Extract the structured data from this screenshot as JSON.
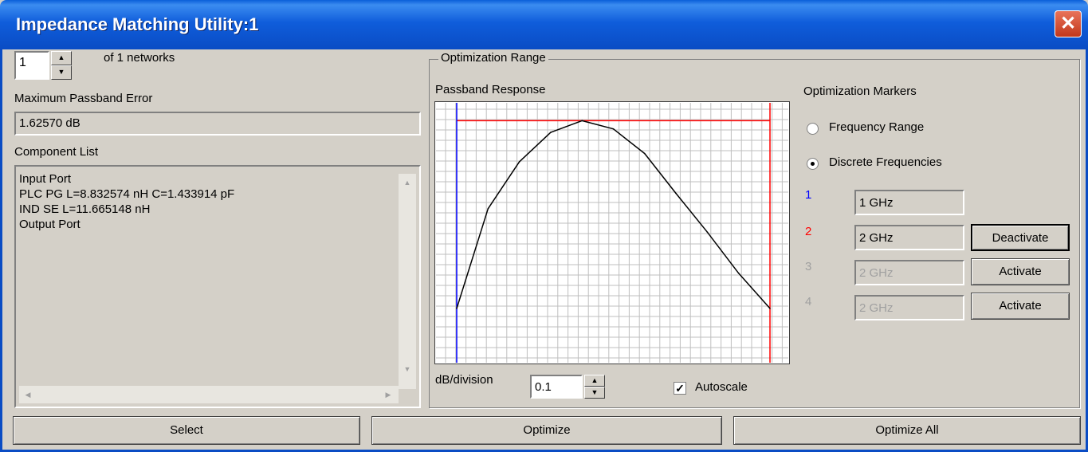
{
  "window": {
    "title": "Impedance Matching Utility:1",
    "close_glyph": "✕"
  },
  "network": {
    "index": "1",
    "of_label": "of 1 networks"
  },
  "passband_error": {
    "label": "Maximum Passband Error",
    "value": "1.62570 dB"
  },
  "component_list": {
    "label": "Component List",
    "lines": [
      "Input Port",
      "PLC  PG  L=8.832574 nH  C=1.433914 pF",
      "IND  SE  L=11.665148 nH",
      "Output Port"
    ]
  },
  "optimization_range": {
    "group_label": "Optimization Range"
  },
  "chart": {
    "label": "Passband Response",
    "db_division_label": "dB/division",
    "db_division_value": "0.1",
    "autoscale_label": "Autoscale",
    "autoscale_checked": true
  },
  "chart_data": {
    "type": "line",
    "title": "Passband Response",
    "xlabel": "",
    "ylabel": "",
    "grid": true,
    "x": [
      0,
      0.1,
      0.2,
      0.3,
      0.4,
      0.5,
      0.6,
      0.7,
      0.8,
      0.9,
      1.0
    ],
    "series": [
      {
        "values": [
          -1.6,
          -0.75,
          -0.35,
          -0.1,
          0.0,
          -0.07,
          -0.28,
          -0.62,
          -0.95,
          -1.3,
          -1.6
        ]
      }
    ],
    "ylim": [
      -1.75,
      0.05
    ],
    "markers": [
      {
        "color": "#0000ff"
      },
      {
        "color": "#ff0000"
      }
    ],
    "colors": {
      "curve": "#000000",
      "grid": "#bfbfbf",
      "top_line": "#ff0000"
    }
  },
  "markers_panel": {
    "label": "Optimization Markers",
    "radio_frequency_range": "Frequency Range",
    "radio_discrete": "Discrete Frequencies",
    "selected": "discrete",
    "markers": [
      {
        "num": "1",
        "value": "1 GHz",
        "button": "",
        "color": "#0000ff",
        "enabled": true
      },
      {
        "num": "2",
        "value": "2 GHz",
        "button": "Deactivate",
        "color": "#ff0000",
        "enabled": true
      },
      {
        "num": "3",
        "value": "2 GHz",
        "button": "Activate",
        "color": "#a0a0a0",
        "enabled": false
      },
      {
        "num": "4",
        "value": "2 GHz",
        "button": "Activate",
        "color": "#a0a0a0",
        "enabled": false
      }
    ]
  },
  "buttons": {
    "select": "Select",
    "optimize": "Optimize",
    "optimize_all": "Optimize All"
  }
}
